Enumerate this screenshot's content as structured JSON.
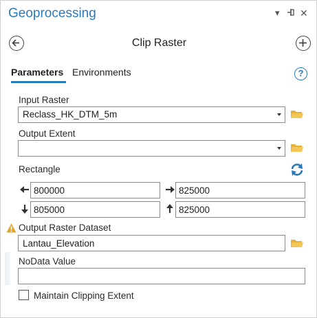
{
  "pane": {
    "title": "Geoprocessing",
    "controls": {
      "menu": "▾",
      "pin": "⊣",
      "close": "✕"
    }
  },
  "header": {
    "tool_name": "Clip Raster",
    "back_icon": "back-arrow-icon",
    "add_icon": "plus-icon"
  },
  "tabs": [
    {
      "label": "Parameters",
      "active": true
    },
    {
      "label": "Environments",
      "active": false
    }
  ],
  "params": {
    "input_raster": {
      "label": "Input Raster",
      "value": "Reclass_HK_DTM_5m"
    },
    "output_extent": {
      "label": "Output Extent",
      "value": ""
    },
    "rectangle": {
      "label": "Rectangle",
      "left": "800000",
      "right": "825000",
      "bottom": "805000",
      "top": "825000"
    },
    "output_raster": {
      "label": "Output Raster Dataset",
      "value": "Lantau_Elevation",
      "warning": true
    },
    "nodata": {
      "label": "NoData Value",
      "value": ""
    },
    "maintain_extent": {
      "label": "Maintain Clipping Extent",
      "checked": false
    }
  },
  "colors": {
    "accent": "#2a7ab9",
    "folder": "#e8b23a",
    "warning": "#e0a526"
  }
}
